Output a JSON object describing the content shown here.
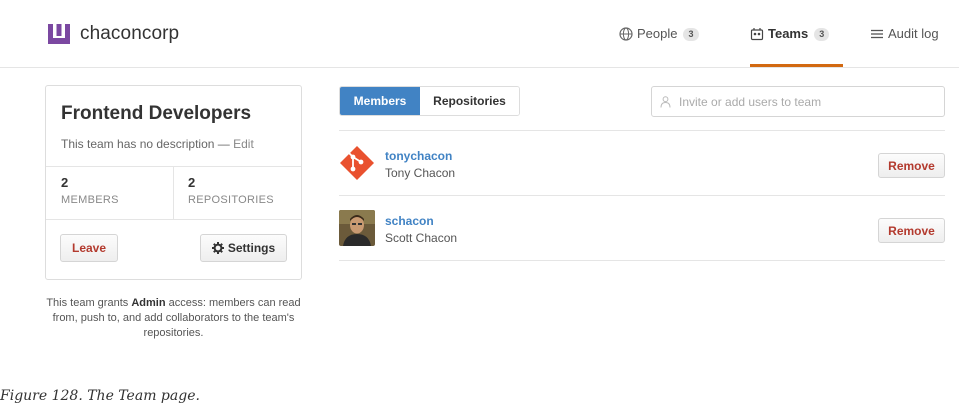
{
  "org": {
    "name": "chaconcorp"
  },
  "nav": {
    "people_label": "People",
    "people_count": "3",
    "teams_label": "Teams",
    "teams_count": "3",
    "audit_label": "Audit log"
  },
  "team": {
    "title": "Frontend Developers",
    "description": "This team has no description",
    "desc_sep": " — ",
    "edit_label": "Edit",
    "members_count": "2",
    "members_label": "MEMBERS",
    "repos_count": "2",
    "repos_label": "REPOSITORIES",
    "leave_label": "Leave",
    "settings_label": "Settings",
    "grant_pre": "This team grants ",
    "grant_level": "Admin",
    "grant_post": " access: members can read from, push to, and add collaborators to the team's repositories."
  },
  "tabs": {
    "members": "Members",
    "repositories": "Repositories"
  },
  "invite": {
    "placeholder": "Invite or add users to team"
  },
  "members": [
    {
      "login": "tonychacon",
      "name": "Tony Chacon",
      "remove_label": "Remove"
    },
    {
      "login": "schacon",
      "name": "Scott Chacon",
      "remove_label": "Remove"
    }
  ],
  "caption": "Figure 128. The Team page.",
  "colors": {
    "link": "#4183c4",
    "danger": "#b33a2e",
    "accent": "#d26911",
    "brand": "#7b48a1"
  }
}
